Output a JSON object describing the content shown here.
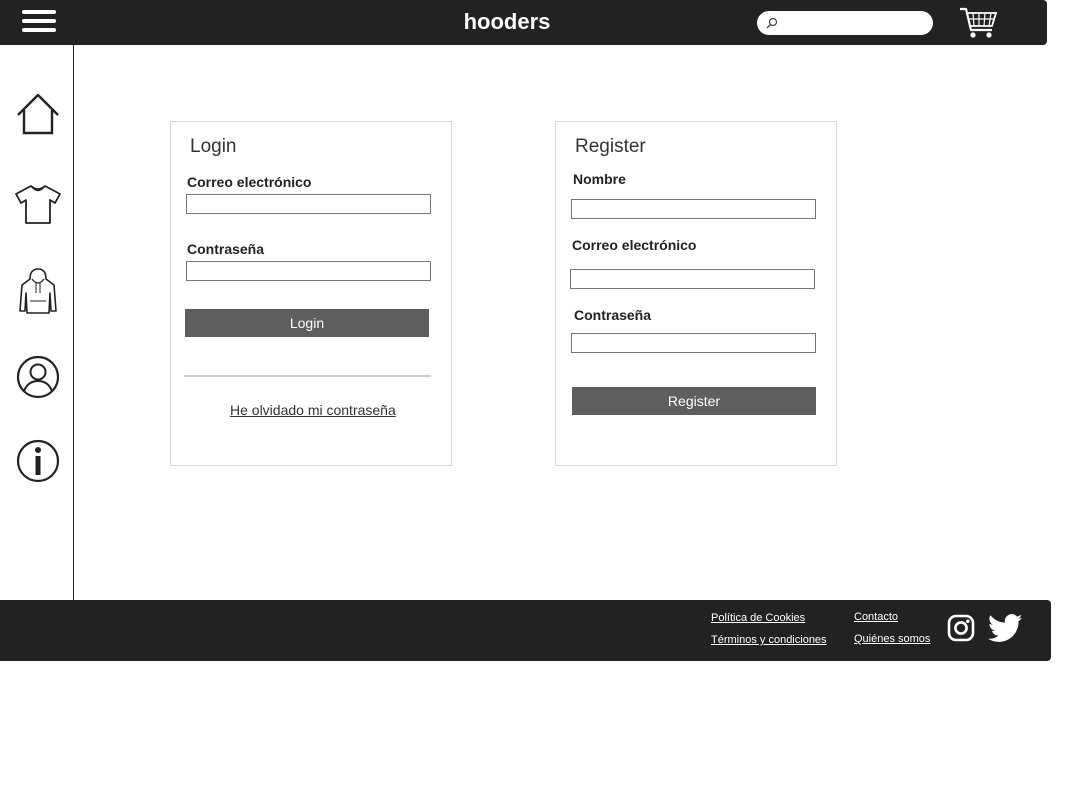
{
  "header": {
    "brand": "hooders",
    "search_placeholder": "",
    "icons": [
      "menu-icon",
      "search-icon",
      "cart-icon"
    ]
  },
  "sidebar": {
    "items": [
      {
        "name": "home",
        "icon": "home-icon"
      },
      {
        "name": "tshirts",
        "icon": "tshirt-icon"
      },
      {
        "name": "hoodies",
        "icon": "hoodie-icon"
      },
      {
        "name": "account",
        "icon": "user-icon"
      },
      {
        "name": "info",
        "icon": "info-icon"
      }
    ]
  },
  "login": {
    "title": "Login",
    "email_label": "Correo electrónico",
    "email_value": "",
    "password_label": "Contraseña",
    "password_value": "",
    "button": "Login",
    "forgot": "He olvidado mi contraseña"
  },
  "register": {
    "title": "Register",
    "name_label": "Nombre",
    "name_value": "",
    "email_label": "Correo electrónico",
    "email_value": "",
    "password_label": "Contraseña",
    "password_value": "",
    "button": "Register"
  },
  "footer": {
    "links": {
      "cookies": "Política de Cookies ",
      "terms": "Términos y condiciones",
      "contact": "Contacto",
      "about": "Quiénes somos"
    },
    "social": [
      "instagram-icon",
      "twitter-icon"
    ]
  },
  "colors": {
    "bar": "#222222",
    "button": "#5e5e5e",
    "card_border": "#d6d6d6"
  }
}
